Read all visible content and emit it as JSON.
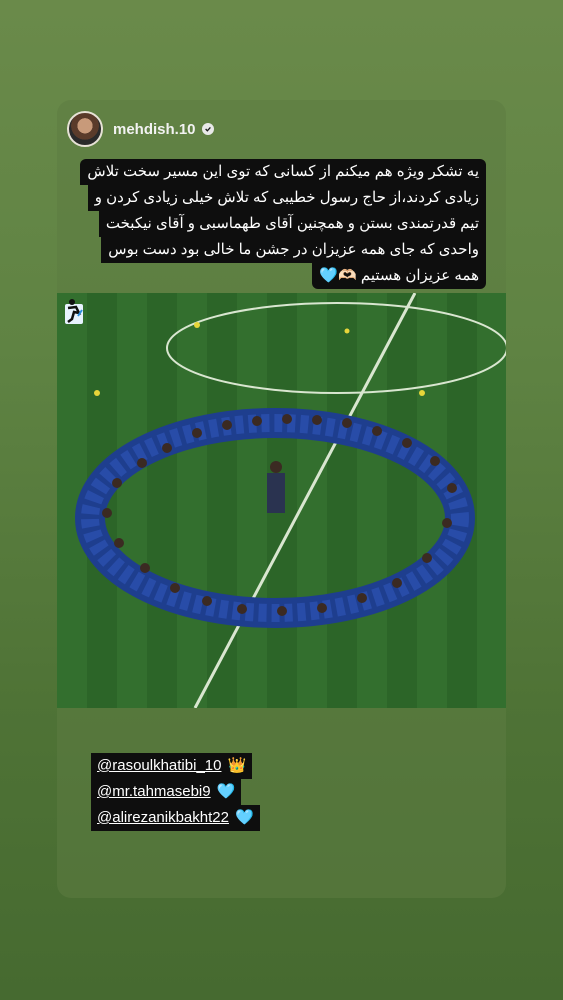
{
  "story": {
    "username": "mehdish.10",
    "caption_lines": [
      "یه تشکر ویژه هم میکنم از کسانی که توی این مسیر سخت تلاش",
      "زیادی کردند،از حاج رسول خطیبی که تلاش خیلی زیادی کردن و",
      "تیم قدرتمندی بستن و همچنین آقای طهماسبی و آقای نیکبخت",
      "واحدی که جای همه عزیزان در جشن ما خالی بود دست بوس",
      "همه عزیزان هستیم 🫶🏻🩵"
    ],
    "mentions": [
      {
        "handle": "@rasoulkhatibi_10",
        "emoji": "👑"
      },
      {
        "handle": "@mr.tahmasebi9",
        "emoji": "🩵"
      },
      {
        "handle": "@alirezanikbakht22",
        "emoji": "🩵"
      }
    ]
  },
  "icons": {
    "verified": "verified-badge-icon",
    "runner": "runner-sticker-icon"
  },
  "colors": {
    "background": "#5f8343",
    "caption_bg": "#0e0e0e",
    "text": "#ffffff",
    "pitch": "#2f6a2b",
    "kit": "#2a4fb0"
  }
}
